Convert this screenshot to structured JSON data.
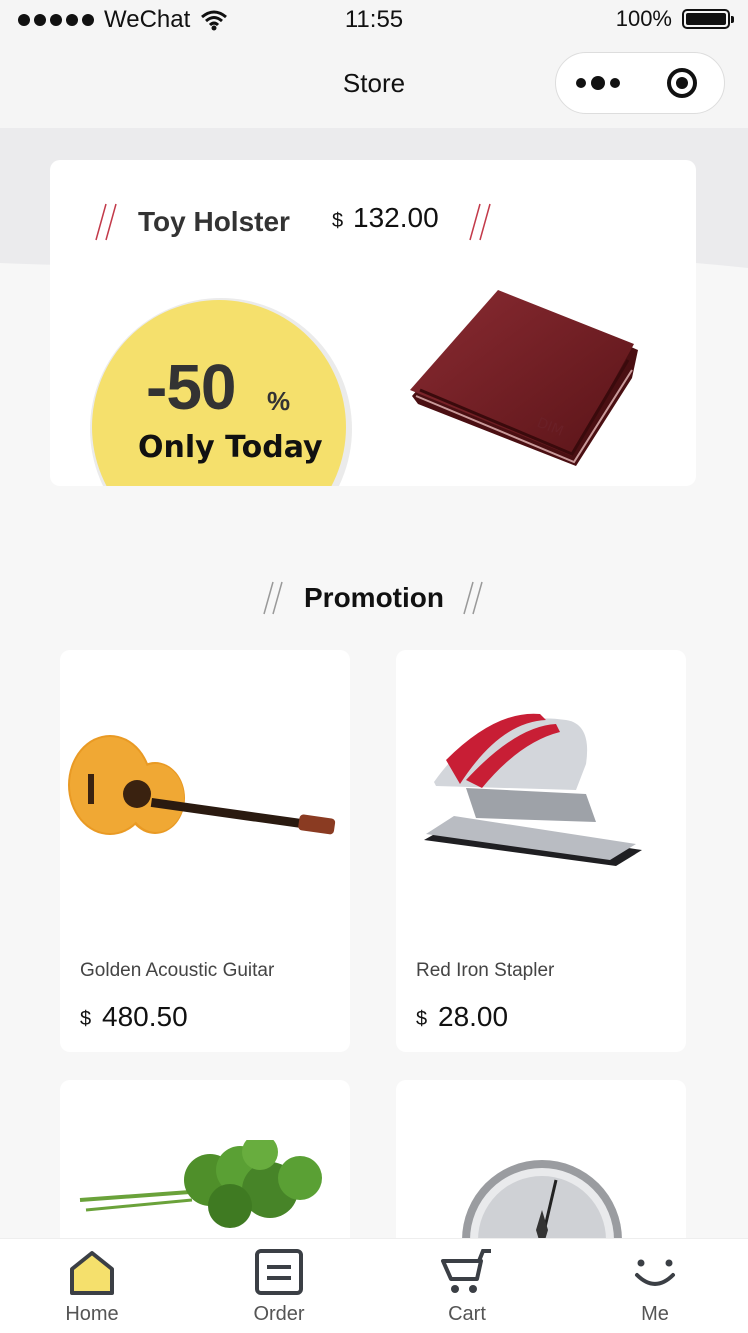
{
  "status_bar": {
    "carrier": "WeChat",
    "time": "11:55",
    "battery": "100%",
    "battery_level": 1.0
  },
  "nav": {
    "title": "Store"
  },
  "featured": {
    "title": "Toy Holster",
    "currency": "$",
    "price": "132.00",
    "discount": "-50",
    "discount_unit": "%",
    "discount_caption": "Only Today",
    "badge_color": "#f5e06c",
    "image_icon": "wallet-image"
  },
  "promotion": {
    "title": "Promotion",
    "products": [
      {
        "name": "Golden Acoustic Guitar",
        "currency": "$",
        "price": "480.50",
        "image_icon": "guitar-image"
      },
      {
        "name": "Red Iron Stapler",
        "currency": "$",
        "price": "28.00",
        "image_icon": "stapler-image"
      },
      {
        "name": "",
        "currency": "",
        "price": "",
        "image_icon": "parsley-image"
      },
      {
        "name": "",
        "currency": "",
        "price": "",
        "image_icon": "barometer-image"
      }
    ]
  },
  "tabbar": {
    "active_color": "#f5e06c",
    "tabs": [
      {
        "label": "Home",
        "icon": "home-icon"
      },
      {
        "label": "Order",
        "icon": "order-icon"
      },
      {
        "label": "Cart",
        "icon": "cart-icon"
      },
      {
        "label": "Me",
        "icon": "smile-icon"
      }
    ]
  }
}
